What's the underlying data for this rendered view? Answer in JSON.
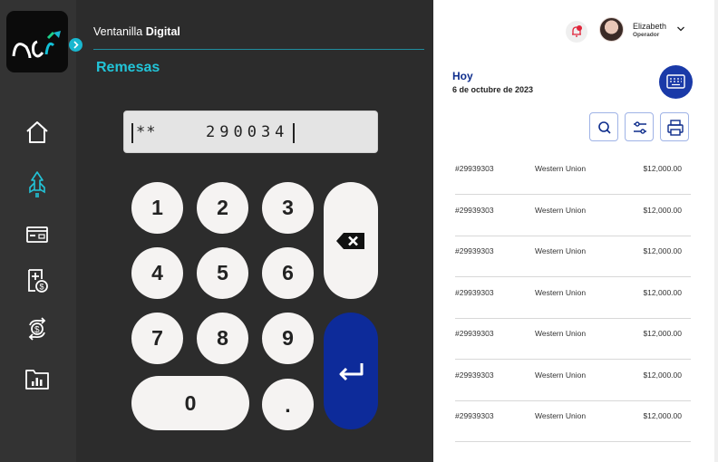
{
  "app": {
    "brand_light": "Ventanilla ",
    "brand_bold": "Digital",
    "section": "Remesas"
  },
  "sidebar": {
    "items": [
      {
        "icon": "home-icon"
      },
      {
        "icon": "rocket-icon"
      },
      {
        "icon": "payment-card-icon"
      },
      {
        "icon": "add-payment-document-icon"
      },
      {
        "icon": "cash-exchange-icon"
      },
      {
        "icon": "reports-folder-icon"
      }
    ]
  },
  "keypad": {
    "display_mask": "**",
    "display_value": "290034",
    "keys": [
      "1",
      "2",
      "3",
      "4",
      "5",
      "6",
      "7",
      "8",
      "9",
      "0",
      "."
    ],
    "backspace_icon": "backspace-icon",
    "enter_icon": "enter-icon"
  },
  "user": {
    "name": "Elizabeth",
    "role": "Operador"
  },
  "list": {
    "title": "Hoy",
    "date": "6 de octubre de 2023",
    "tools": [
      "search-icon",
      "filter-icon",
      "print-icon"
    ],
    "rows": [
      {
        "id": "#29939303",
        "provider": "Western Union",
        "amount": "$12,000.00"
      },
      {
        "id": "#29939303",
        "provider": "Western Union",
        "amount": "$12,000.00"
      },
      {
        "id": "#29939303",
        "provider": "Western Union",
        "amount": "$12,000.00"
      },
      {
        "id": "#29939303",
        "provider": "Western Union",
        "amount": "$12,000.00"
      },
      {
        "id": "#29939303",
        "provider": "Western Union",
        "amount": "$12,000.00"
      },
      {
        "id": "#29939303",
        "provider": "Western Union",
        "amount": "$12,000.00"
      },
      {
        "id": "#29939303",
        "provider": "Western Union",
        "amount": "$12,000.00"
      }
    ]
  },
  "colors": {
    "accent": "#22c4d8",
    "primary": "#0d2b9a",
    "sidebar": "#333333",
    "panel": "#2c2c2c"
  }
}
